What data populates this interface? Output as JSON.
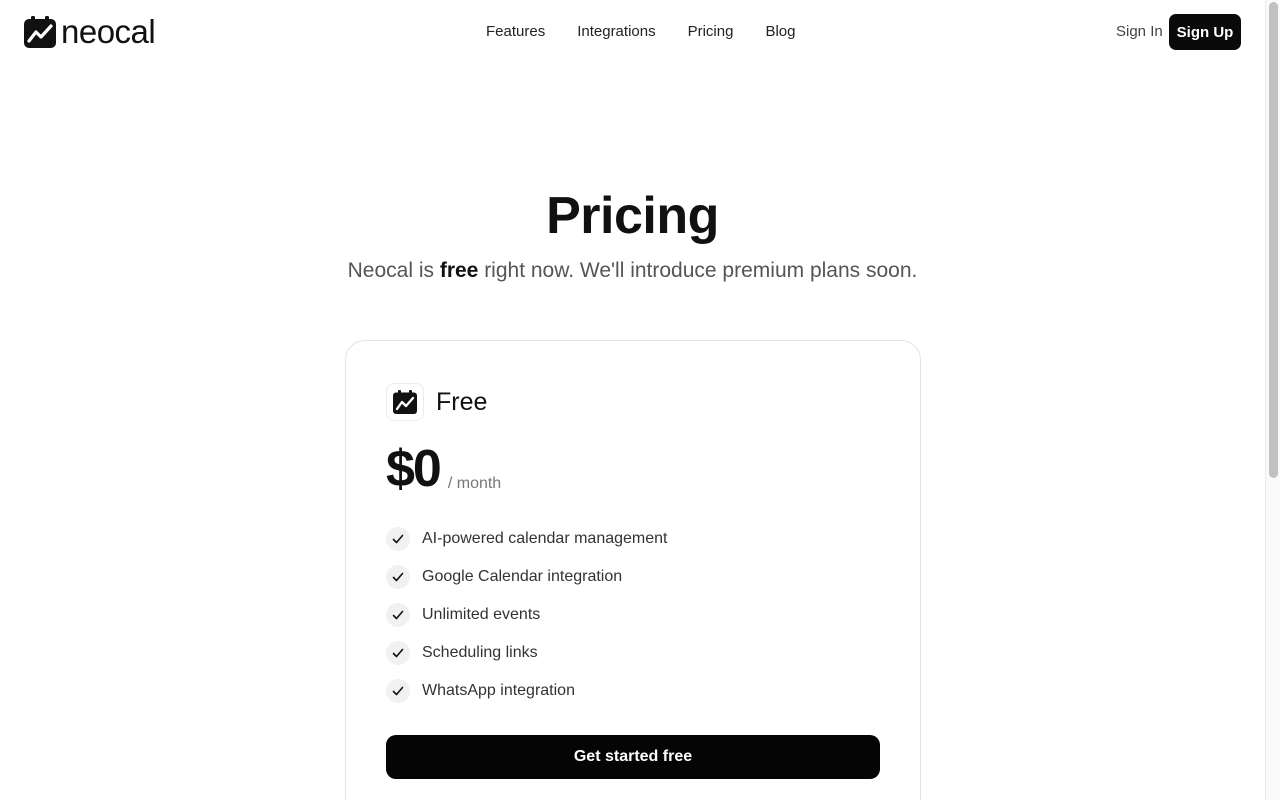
{
  "brand": {
    "name": "neocal",
    "icon": "calendar-chart-logo-icon"
  },
  "nav": {
    "links": [
      {
        "label": "Features"
      },
      {
        "label": "Integrations"
      },
      {
        "label": "Pricing"
      },
      {
        "label": "Blog"
      }
    ],
    "sign_in": "Sign In",
    "sign_up": "Sign Up"
  },
  "hero": {
    "title": "Pricing",
    "subtitle_prefix": "Neocal is ",
    "subtitle_bold": "free",
    "subtitle_suffix": " right now. We'll introduce premium plans soon."
  },
  "plan": {
    "icon": "calendar-chart-icon",
    "name": "Free",
    "price": "$0",
    "period": "/ month",
    "check_icon": "check-icon",
    "features": [
      {
        "label": "AI-powered calendar management"
      },
      {
        "label": "Google Calendar integration"
      },
      {
        "label": "Unlimited events"
      },
      {
        "label": "Scheduling links"
      },
      {
        "label": "WhatsApp integration"
      }
    ],
    "cta": "Get started free"
  },
  "colors": {
    "primary": "#0a0a0a",
    "text": "#111111",
    "muted": "#555555",
    "border": "#e3e3e3",
    "check_bg": "#f1f1f1"
  }
}
